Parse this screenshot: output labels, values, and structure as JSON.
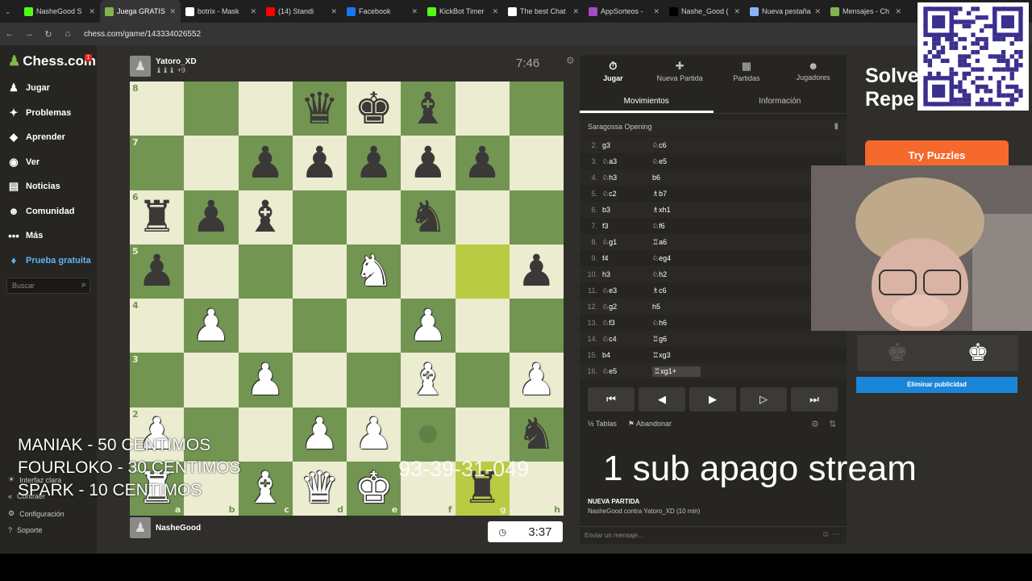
{
  "browser": {
    "tabs": [
      {
        "label": "NasheGood S",
        "color": "#53fc18"
      },
      {
        "label": "Juega GRATIS",
        "color": "#81b64c",
        "active": true
      },
      {
        "label": "botrix - Mask",
        "color": "#ffffff"
      },
      {
        "label": "(14) Standi",
        "color": "#ff0000"
      },
      {
        "label": "Facebook",
        "color": "#1877f2"
      },
      {
        "label": "KickBot Timer",
        "color": "#53fc18"
      },
      {
        "label": "The best Chat",
        "color": "#ffffff"
      },
      {
        "label": "AppSorteos -",
        "color": "#a64ac9"
      },
      {
        "label": "Nashe_Good (",
        "color": "#000000"
      },
      {
        "label": "Nueva pestaña",
        "color": "#8ab4f8"
      },
      {
        "label": "Mensajes - Ch",
        "color": "#81b64c"
      }
    ],
    "url": "chess.com/game/143334026552"
  },
  "sidebar": {
    "logo": "Chess.com",
    "badge": "1",
    "items": [
      {
        "label": "Jugar",
        "icon": "♟"
      },
      {
        "label": "Problemas",
        "icon": "✦"
      },
      {
        "label": "Aprender",
        "icon": "◆"
      },
      {
        "label": "Ver",
        "icon": "◉"
      },
      {
        "label": "Noticias",
        "icon": "▤"
      },
      {
        "label": "Comunidad",
        "icon": "☻"
      },
      {
        "label": "Más",
        "icon": "•••"
      },
      {
        "label": "Prueba gratuita",
        "icon": "♦"
      }
    ],
    "search_placeholder": "Buscar",
    "bottom": [
      {
        "label": "Interfaz clara"
      },
      {
        "label": "Contraer"
      },
      {
        "label": "Configuración"
      },
      {
        "label": "Soporte"
      }
    ]
  },
  "top_player": {
    "name": "Yatoro_XD",
    "captured": "♝♝♝ +9",
    "clock": "7:46"
  },
  "bottom_player": {
    "name": "NasheGood",
    "clock": "3:37"
  },
  "board": {
    "ranks": [
      "8",
      "7",
      "6",
      "5",
      "4",
      "3",
      "2",
      "1"
    ],
    "files": [
      "a",
      "b",
      "c",
      "d",
      "e",
      "f",
      "g",
      "h"
    ],
    "rows": [
      [
        "",
        "",
        "",
        "bq",
        "bk",
        "bb",
        "",
        ""
      ],
      [
        "",
        "",
        "bp",
        "bp",
        "bp",
        "bp",
        "bp",
        ""
      ],
      [
        "br",
        "bp",
        "bb",
        "",
        "",
        "bn",
        "",
        ""
      ],
      [
        "bp",
        "",
        "",
        "",
        "wn",
        "",
        "",
        "bp"
      ],
      [
        "",
        "wp",
        "",
        "",
        "",
        "wp",
        "",
        ""
      ],
      [
        "",
        "",
        "wp",
        "",
        "",
        "wb",
        "",
        "wp"
      ],
      [
        "wp",
        "",
        "",
        "wp",
        "wp",
        "",
        "",
        "bn"
      ],
      [
        "wr",
        "",
        "wb",
        "wq",
        "wk",
        "",
        "br",
        ""
      ]
    ],
    "highlight": [
      "3-6",
      "7-6"
    ],
    "dots": [
      "6-5"
    ]
  },
  "panel": {
    "tabs": [
      {
        "label": "Jugar",
        "icon": "⏱"
      },
      {
        "label": "Nueva Partida",
        "icon": "✚"
      },
      {
        "label": "Partidas",
        "icon": "▦"
      },
      {
        "label": "Jugadores",
        "icon": "☻"
      }
    ],
    "subtabs": [
      "Movimientos",
      "Información"
    ],
    "opening": "Saragossa Opening",
    "moves": [
      {
        "n": "2.",
        "w": "g3",
        "b": "♘c6"
      },
      {
        "n": "3.",
        "w": "♘a3",
        "b": "♘e5"
      },
      {
        "n": "4.",
        "w": "♘h3",
        "b": "b6"
      },
      {
        "n": "5.",
        "w": "♘c2",
        "b": "♗b7"
      },
      {
        "n": "6.",
        "w": "b3",
        "b": "♗xh1"
      },
      {
        "n": "7.",
        "w": "f3",
        "b": "♘f6"
      },
      {
        "n": "8.",
        "w": "♘g1",
        "b": "♖a6"
      },
      {
        "n": "9.",
        "w": "f4",
        "b": "♘eg4"
      },
      {
        "n": "10.",
        "w": "h3",
        "b": "♘h2"
      },
      {
        "n": "11.",
        "w": "♘e3",
        "b": "♗c6"
      },
      {
        "n": "12.",
        "w": "♘g2",
        "b": "h5"
      },
      {
        "n": "13.",
        "w": "♘f3",
        "b": "♘h6"
      },
      {
        "n": "14.",
        "w": "♘c4",
        "b": "♖g6"
      },
      {
        "n": "15.",
        "w": "b4",
        "b": "♖xg3"
      },
      {
        "n": "16.",
        "w": "♘e5",
        "b": "♖xg1+"
      }
    ],
    "controls": [
      "⏮",
      "◀",
      "▶",
      "▷",
      "⏭"
    ],
    "actions": [
      "Tablas",
      "Abandonar"
    ],
    "new_game_title": "NUEVA PARTIDA",
    "new_game_desc": "NasheGood contra Yatoro_XD (10 min)",
    "message_placeholder": "Enviar un mensaje..."
  },
  "ad": {
    "headline1": "Solve",
    "headline2": "Repe",
    "button": "Try Puzzles",
    "remove": "Eliminar publicidad"
  },
  "overlay": {
    "donations": [
      "MANIAK - 50 CENTIMOS",
      "FOURLOKO - 30 CENTIMOS",
      "SPARK - 10 CENTIMOS"
    ],
    "phone": "93-39-31-049",
    "sub": "1 sub  apago stream"
  }
}
